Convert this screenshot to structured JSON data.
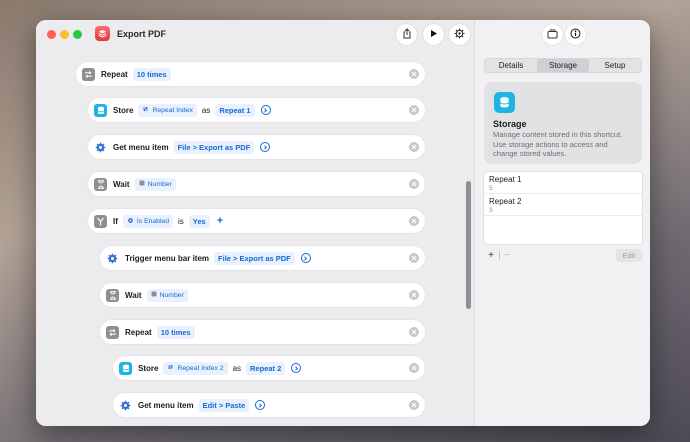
{
  "window": {
    "title": "Export PDF"
  },
  "actions": [
    {
      "name": "Repeat",
      "token": "10 times"
    },
    {
      "name": "Store",
      "var": "Repeat Index",
      "as": "as",
      "target": "Repeat 1"
    },
    {
      "name": "Get menu item",
      "path": "File > Export as PDF"
    },
    {
      "name": "Wait",
      "var": "Number"
    },
    {
      "name": "If",
      "var": "Is Enabled",
      "is": "is",
      "value": "Yes"
    },
    {
      "name": "Trigger menu bar item",
      "path": "File > Export as PDF"
    },
    {
      "name": "Wait",
      "var": "Number"
    },
    {
      "name": "Repeat",
      "token": "10 times"
    },
    {
      "name": "Store",
      "var": "Repeat Index 2",
      "as": "as",
      "target": "Repeat 2"
    },
    {
      "name": "Get menu item",
      "path_a": "Edit",
      "sep": ">",
      "path_b": "Paste"
    }
  ],
  "inspector": {
    "tabs": [
      {
        "label": "Details"
      },
      {
        "label": "Storage"
      },
      {
        "label": "Setup"
      }
    ],
    "active_tab": "Storage",
    "storage": {
      "title": "Storage",
      "description": "Manage content stored in this shortcut. Use storage actions to access and change stored values.",
      "items": [
        {
          "name": "Repeat 1",
          "value": "5"
        },
        {
          "name": "Repeat 2",
          "value": "3"
        }
      ],
      "add_label": "+",
      "remove_label": "−",
      "edit_label": "Edit"
    }
  },
  "colors": {
    "accent": "#1769d1",
    "storage_icon": "#1fb4e4",
    "token_bg": "#e8f1fd"
  },
  "icons": {
    "repeat": "repeat-icon",
    "store": "database-icon",
    "gear": "gear-icon",
    "wait": "hourglass-icon",
    "if": "branch-icon",
    "share": "share-icon",
    "run": "play-icon",
    "settings": "settings-icon",
    "library": "library-icon",
    "info": "info-icon"
  }
}
